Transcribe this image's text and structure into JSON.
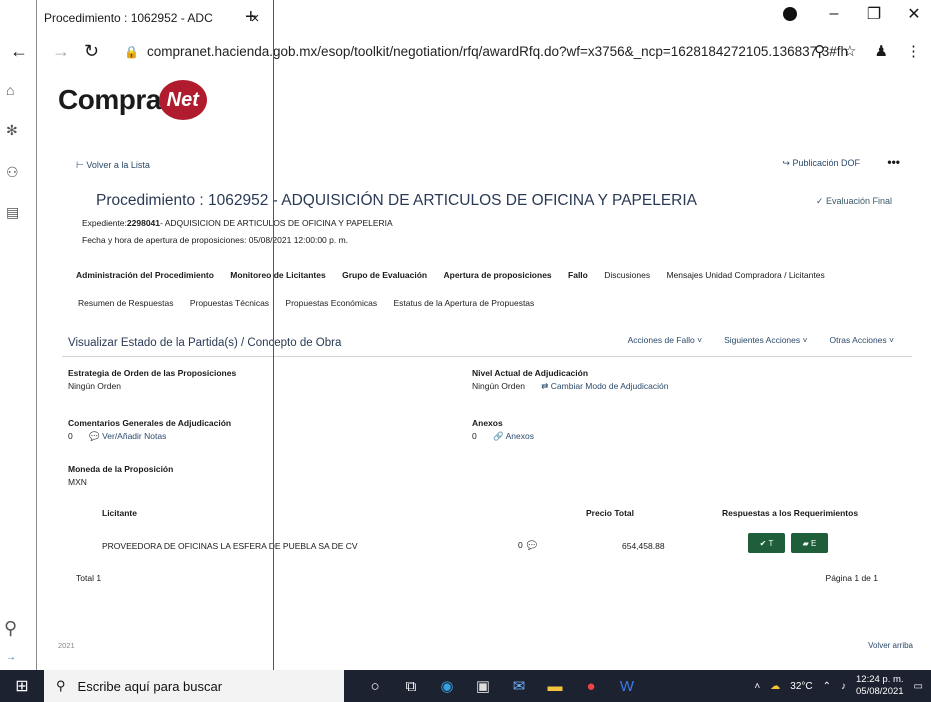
{
  "browser": {
    "tab_title": "Procedimiento : 1062952 - ADC",
    "tab_close": "×",
    "new_tab": "+",
    "url": "compranet.hacienda.gob.mx/esop/toolkit/negotiation/rfq/awardRfq.do?wf=x3756&_ncp=1628184272105.136837-3#fh"
  },
  "logo": {
    "compra": "Compra",
    "net": "Net"
  },
  "header": {
    "back_label": "Volver a la Lista",
    "publication_label": "Publicación DOF",
    "more_label": "•••"
  },
  "procedure": {
    "title": "Procedimiento : 1062952 - ADQUISICIÓN DE ARTICULOS DE OFICINA Y PAPELERIA",
    "status": "Evaluación Final",
    "expediente_label": "Expediente:",
    "expediente_value": "2298041",
    "expediente_desc": "- ADQUISICION DE ARTICULOS DE OFICINA Y PAPELERIA",
    "fecha": "Fecha y hora de apertura de proposiciones: 05/08/2021 12:00:00 p. m."
  },
  "tabs_row1": [
    "Administración del Procedimiento",
    "Monitoreo de Licitantes",
    "Grupo de Evaluación",
    "Apertura de proposiciones",
    "Fallo",
    "Discusiones",
    "Mensajes Unidad Compradora / Licitantes"
  ],
  "tabs_row2": [
    "Resumen de Respuestas",
    "Propuestas Técnicas",
    "Propuestas Económicas",
    "Estatus de la Apertura de Propuestas"
  ],
  "section": {
    "title": "Visualizar Estado de la Partida(s) / Concepto de Obra",
    "actions": [
      "Acciones de Fallo",
      "Siguientes Acciones",
      "Otras Acciones"
    ]
  },
  "fields": {
    "estrategia_label": "Estrategia de Orden de las Proposiciones",
    "estrategia_value": "Ningún Orden",
    "nivel_label": "Nivel Actual de Adjudicación",
    "nivel_value": "Ningún Orden",
    "cambiar_modo": "Cambiar Modo de Adjudicación",
    "comentarios_label": "Comentarios Generales de Adjudicación",
    "comentarios_value": "0",
    "ver_notas": "Ver/Añadir Notas",
    "anexos_label": "Anexos",
    "anexos_value": "0",
    "anexos_link": "Anexos",
    "moneda_label": "Moneda de la Proposición",
    "moneda_value": "MXN"
  },
  "table": {
    "col_licitante": "Licitante",
    "col_precio": "Precio Total",
    "col_respuestas": "Respuestas a los Requerimientos",
    "rows": [
      {
        "licitante": "PROVEEDORA DE OFICINAS LA ESFERA DE PUEBLA SA DE CV",
        "count": "0",
        "precio": "654,458.88",
        "btn_t": "T",
        "btn_e": "E"
      }
    ]
  },
  "footer": {
    "total": "Total 1",
    "pagina": "Página 1 de 1",
    "year": "2021",
    "volver_arriba": "Volver arriba"
  },
  "taskbar": {
    "search_placeholder": "Escribe aquí para buscar",
    "weather": "32°C",
    "time": "12:24 p. m.",
    "date": "05/08/2021"
  },
  "colors": {
    "brand_red": "#b01c2e",
    "green_button": "#1f5e3a",
    "link": "#2a4a6a",
    "taskbar": "#1c2230"
  }
}
